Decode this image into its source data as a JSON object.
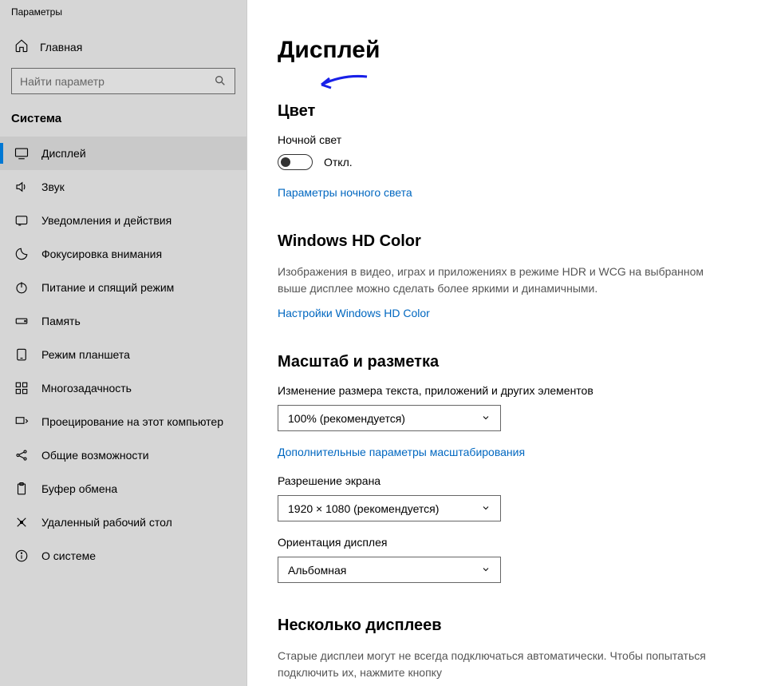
{
  "window_title": "Параметры",
  "home_label": "Главная",
  "search_placeholder": "Найти параметр",
  "sidebar_section": "Система",
  "nav": [
    {
      "label": "Дисплей"
    },
    {
      "label": "Звук"
    },
    {
      "label": "Уведомления и действия"
    },
    {
      "label": "Фокусировка внимания"
    },
    {
      "label": "Питание и спящий режим"
    },
    {
      "label": "Память"
    },
    {
      "label": "Режим планшета"
    },
    {
      "label": "Многозадачность"
    },
    {
      "label": "Проецирование на этот компьютер"
    },
    {
      "label": "Общие возможности"
    },
    {
      "label": "Буфер обмена"
    },
    {
      "label": "Удаленный рабочий стол"
    },
    {
      "label": "О системе"
    }
  ],
  "main": {
    "title": "Дисплей",
    "color": {
      "heading": "Цвет",
      "night_light_label": "Ночной свет",
      "night_light_state": "Откл.",
      "night_light_link": "Параметры ночного света"
    },
    "hd": {
      "heading": "Windows HD Color",
      "desc": "Изображения в видео, играх и приложениях в режиме HDR и WCG на выбранном выше дисплее можно сделать более яркими и динамичными.",
      "link": "Настройки Windows HD Color"
    },
    "scale": {
      "heading": "Масштаб и разметка",
      "size_label": "Изменение размера текста, приложений и других элементов",
      "size_value": "100% (рекомендуется)",
      "adv_link": "Дополнительные параметры масштабирования",
      "res_label": "Разрешение экрана",
      "res_value": "1920 × 1080 (рекомендуется)",
      "orient_label": "Ориентация дисплея",
      "orient_value": "Альбомная"
    },
    "multi": {
      "heading": "Несколько дисплеев",
      "desc": "Старые дисплеи могут не всегда подключаться автоматически. Чтобы попытаться подключить их, нажмите кнопку"
    }
  }
}
